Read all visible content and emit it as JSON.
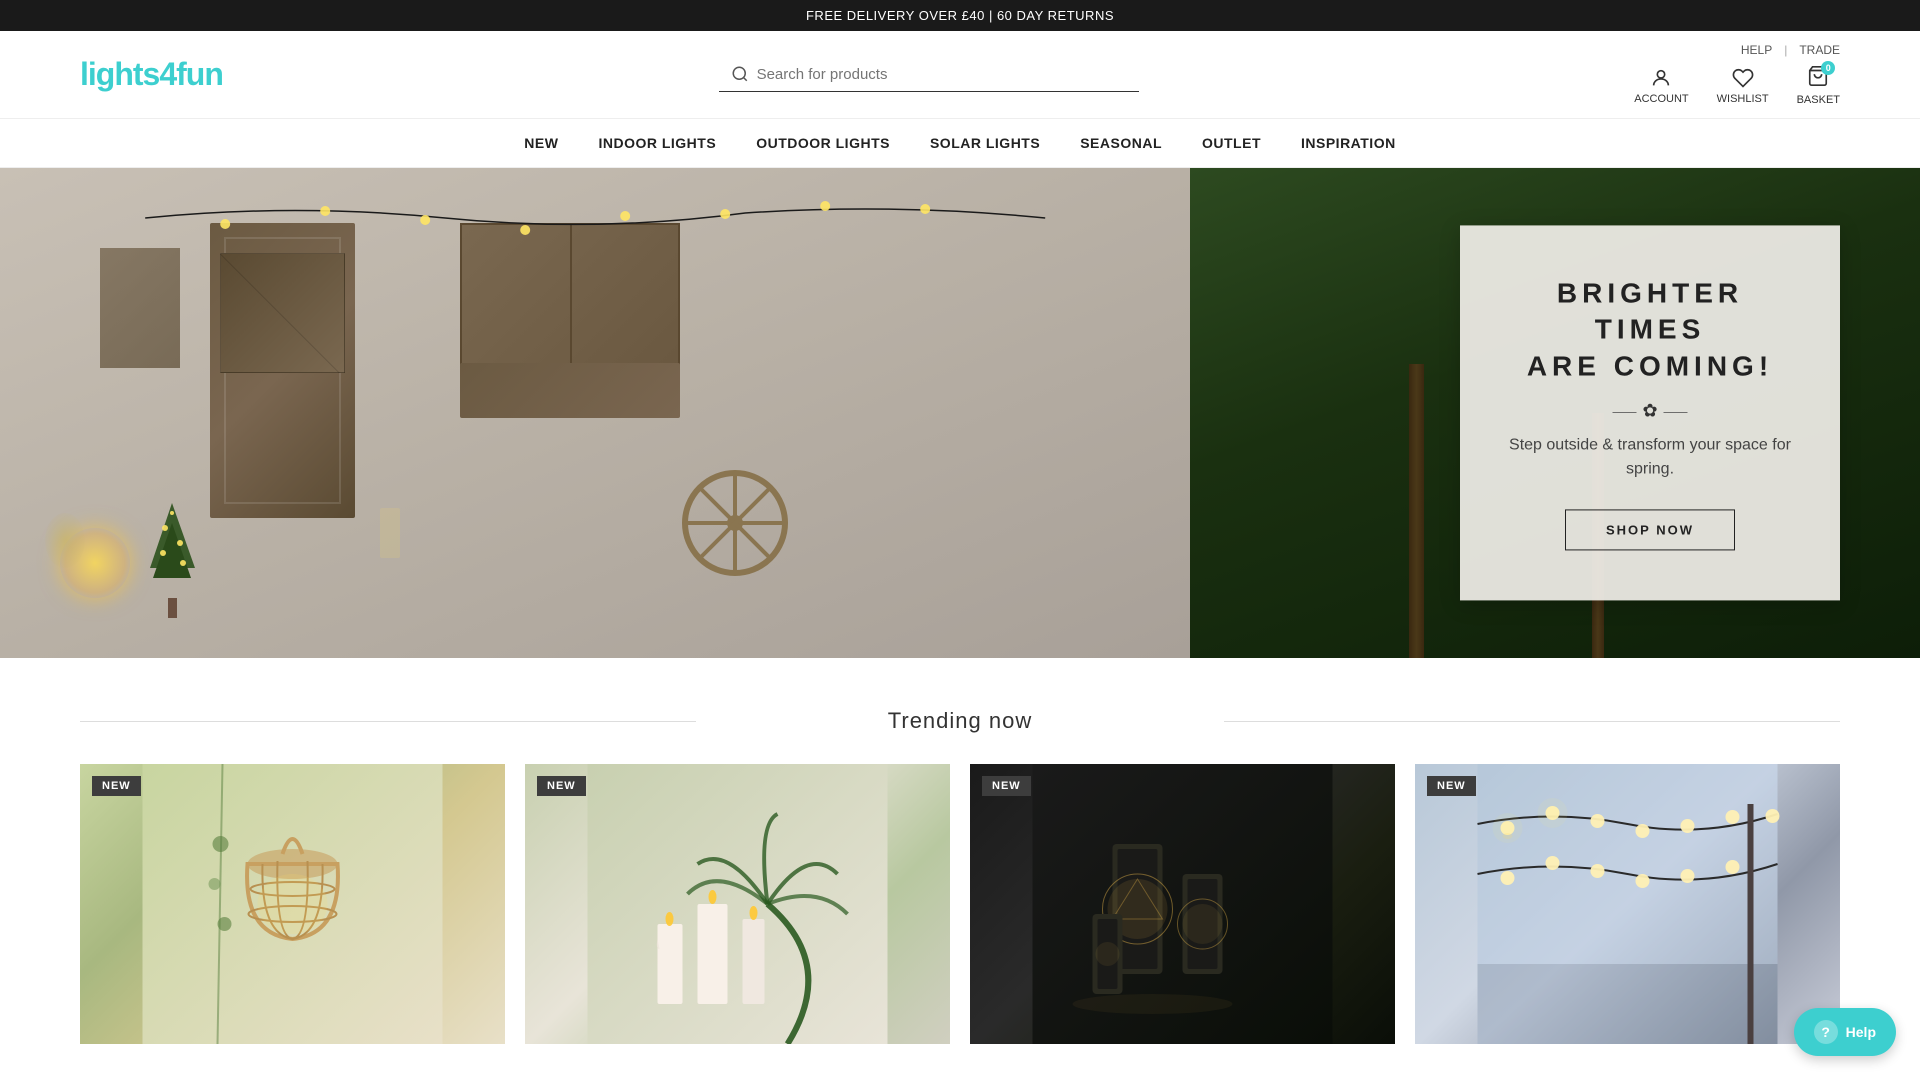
{
  "topBanner": {
    "text": "FREE DELIVERY OVER £40  |  60 DAY RETURNS"
  },
  "header": {
    "logoText": "lights4fun",
    "search": {
      "placeholder": "Search for products"
    },
    "topLinks": [
      {
        "label": "HELP",
        "id": "help-link"
      },
      {
        "label": "TRADE",
        "id": "trade-link"
      }
    ],
    "actions": [
      {
        "label": "ACCOUNT",
        "id": "account"
      },
      {
        "label": "WISHLIST",
        "id": "wishlist"
      },
      {
        "label": "BASKET",
        "id": "basket",
        "badge": "0"
      }
    ]
  },
  "nav": {
    "items": [
      {
        "label": "NEW",
        "id": "nav-new"
      },
      {
        "label": "INDOOR LIGHTS",
        "id": "nav-indoor"
      },
      {
        "label": "OUTDOOR LIGHTS",
        "id": "nav-outdoor"
      },
      {
        "label": "SOLAR LIGHTS",
        "id": "nav-solar"
      },
      {
        "label": "SEASONAL",
        "id": "nav-seasonal"
      },
      {
        "label": "OUTLET",
        "id": "nav-outlet"
      },
      {
        "label": "INSPIRATION",
        "id": "nav-inspiration"
      }
    ]
  },
  "hero": {
    "headline1": "BRIGHTER TIMES",
    "headline2": "ARE COMING!",
    "flowerIcon": "✿",
    "subtext": "Step outside & transform your space for spring.",
    "ctaLabel": "SHOP NOW"
  },
  "trending": {
    "sectionTitle": "Trending now",
    "products": [
      {
        "badge": "NEW",
        "id": "product-1"
      },
      {
        "badge": "NEW",
        "id": "product-2"
      },
      {
        "badge": "NEW",
        "id": "product-3"
      },
      {
        "badge": "NEW",
        "id": "product-4"
      }
    ]
  },
  "helpButton": {
    "label": "Help"
  }
}
